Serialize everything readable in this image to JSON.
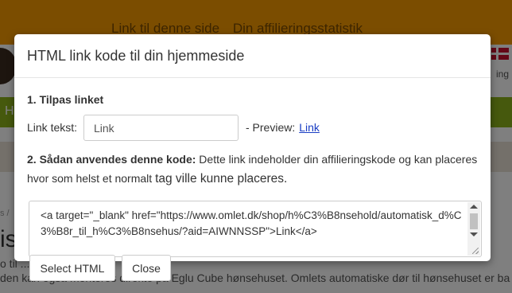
{
  "background": {
    "topbar_links": [
      "Link til denne side",
      "Din affilieringsstatistik"
    ],
    "head_text": "ing",
    "nav_text": "H",
    "title_text": "is",
    "crumb": "s /",
    "body_lines": [
      "o                                    til ... tilpasset",
      "den kan også monteres direkte på Eglu Cube hønsehuset. Omlets automatiske dør til hønsehuset er ba"
    ]
  },
  "modal": {
    "title": "HTML link kode til din hjemmeside",
    "section1_title": "1. Tilpas linket",
    "link_text_label": "Link tekst:",
    "link_text_value": "Link",
    "preview_label": "- Preview:",
    "preview_link": "Link",
    "section2_title": "2. Sådan anvendes denne kode:",
    "section2_text_a": " Dette link indeholder din affilieringskode og kan placeres hvor som helst et normalt ",
    "section2_text_b": "tag ville kunne placeres.",
    "code": "<a target=\"_blank\" href=\"https://www.omlet.dk/shop/h%C3%B8nsehold/automatisk_d%C3%B8r_til_h%C3%B8nsehus/?aid=AIWNNSSP\">Link</a>",
    "select_button": "Select HTML",
    "close_button": "Close"
  },
  "colors": {
    "topbar": "#f79a00",
    "nav": "#8cb31a",
    "link": "#1a3ec4"
  }
}
